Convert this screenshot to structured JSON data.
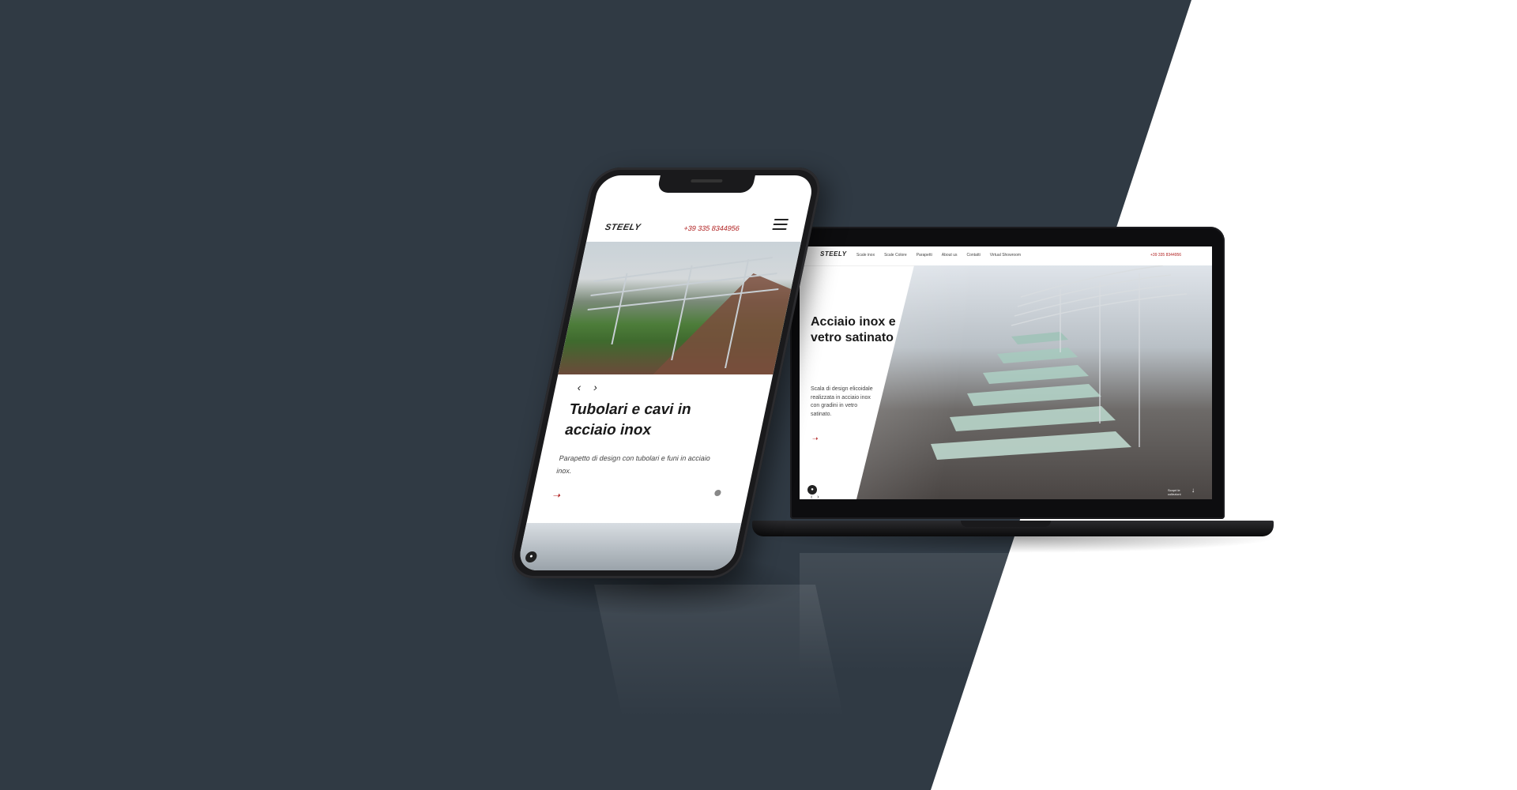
{
  "laptop": {
    "nav": {
      "logo": "STEELY",
      "menu": [
        "Scale inox",
        "Scale Colore",
        "Parapetti",
        "About us",
        "Contatti",
        "Virtual Showroom"
      ],
      "phone": "+39 335 8344956"
    },
    "hero": {
      "title": "Acciaio inox e vetro satinato",
      "description": "Scala di design elicoidale realizzata in acciaio inox con gradini in vetro satinato.",
      "arrow_icon": "arrow-right-icon",
      "carousel_prev": "‹",
      "carousel_next": "›",
      "discover": "Scopri le collezioni"
    }
  },
  "phone": {
    "logo": "STEELY",
    "phone_number": "+39 335 8344956",
    "carousel_arrows": "‹ ›",
    "title": "Tubolari e cavi in acciaio inox",
    "description": "Parapetto di design con tubolari e funi in acciaio inox.",
    "arrow_icon": "arrow-right-icon"
  },
  "colors": {
    "background_dark": "#303a44",
    "background_light": "#ffffff",
    "accent_red": "#b02020"
  }
}
